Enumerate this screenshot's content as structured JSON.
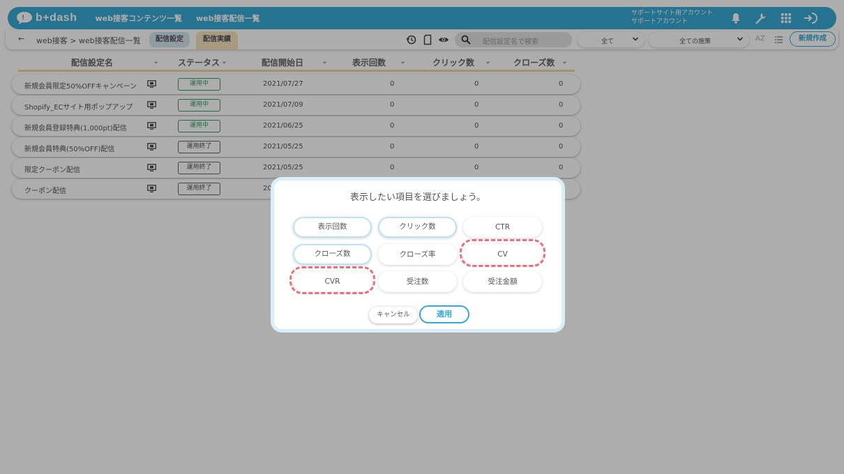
{
  "app": {
    "logo_text": "b+dash",
    "nav": [
      "web接客コンテンツ一覧",
      "web接客配信一覧"
    ],
    "support_lines": [
      "サポートサイト用アカウント",
      "サポートアカウント"
    ]
  },
  "toolbar": {
    "breadcrumb": "web接客 > web接客配信一覧",
    "tab_settings": "配信設定",
    "tab_results": "配信実績",
    "search_placeholder": "配信設定名で検索",
    "filter_all": "全て",
    "filter_measures": "全ての施策",
    "sort_label": "AZ",
    "new_button": "新規作成"
  },
  "table": {
    "headers": [
      "配信設定名",
      "ステータス",
      "配信開始日",
      "表示回数",
      "クリック数",
      "クローズ数"
    ],
    "rows": [
      {
        "name": "新規会員限定50%OFFキャンペーン",
        "status": "運用中",
        "date": "2021/07/27",
        "views": "0",
        "clicks": "0",
        "closes": "0"
      },
      {
        "name": "Shopify_ECサイト用ポップアップ",
        "status": "運用中",
        "date": "2021/07/09",
        "views": "0",
        "clicks": "0",
        "closes": "0"
      },
      {
        "name": "新規会員登録特典(1,000pt)配信",
        "status": "運用中",
        "date": "2021/06/25",
        "views": "0",
        "clicks": "0",
        "closes": "0"
      },
      {
        "name": "新規会員特典(50%OFF)配信",
        "status": "運用終了",
        "date": "2021/05/25",
        "views": "0",
        "clicks": "0",
        "closes": "0"
      },
      {
        "name": "限定クーポン配信",
        "status": "運用終了",
        "date": "2021/05/25",
        "views": "0",
        "clicks": "0",
        "closes": "0"
      },
      {
        "name": "クーポン配信",
        "status": "運用終了",
        "date": "20",
        "views": "",
        "clicks": "",
        "closes": ""
      }
    ]
  },
  "modal": {
    "title": "表示したい項目を選びましょう。",
    "options": [
      {
        "label": "表示回数",
        "selected": true
      },
      {
        "label": "クリック数",
        "selected": true
      },
      {
        "label": "CTR",
        "selected": false
      },
      {
        "label": "クローズ数",
        "selected": true
      },
      {
        "label": "クローズ率",
        "selected": false
      },
      {
        "label": "CV",
        "selected": false
      },
      {
        "label": "CVR",
        "selected": false
      },
      {
        "label": "受注数",
        "selected": false
      },
      {
        "label": "受注金額",
        "selected": false
      }
    ],
    "cancel": "キャンセル",
    "apply": "適用"
  },
  "colors": {
    "brand": "#39a8d6",
    "active_status": "#2f9e68",
    "highlight": "#e96f7a",
    "results_tab": "#f5e6b8"
  }
}
